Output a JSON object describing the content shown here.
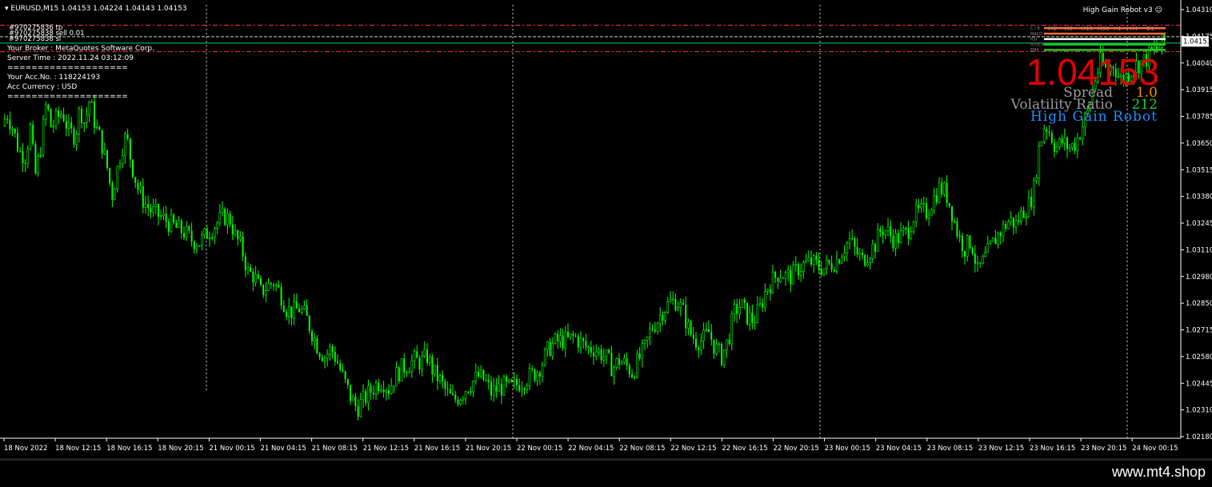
{
  "window": {
    "symbol_header": "EURUSD,M15  1.04153 1.04224 1.04143 1.04153",
    "ea_label": "High Gain Robot v3",
    "watermark": "www.mt4.shop"
  },
  "trade_labels": [
    "#970275836 tp",
    "#970275838 sell 0.01",
    "#970275838 sl"
  ],
  "account_info": [
    "Your Broker  : MetaQuotes Software Corp.",
    "Server Time : 2022.11.24 03:12:09",
    "====================",
    "Your Acc.No.  : 118224193",
    "Acc Currency  : USD",
    "===================="
  ],
  "price_display": {
    "value": "1.04153",
    "spread_label": "Spread",
    "spread_value": "1.0",
    "volatility_label": "Volatility Ratio",
    "volatility_value": "212",
    "robot_name": "High Gain Robot"
  },
  "dashboard": {
    "timeframes": [
      "M1",
      "M5",
      "M15",
      "M30",
      "H1",
      "H4",
      "D1"
    ],
    "rows": [
      "C / B",
      "MACD",
      "RSI",
      "STOCH",
      "EMA"
    ]
  },
  "current_price_tag": "1.04153",
  "colors": {
    "up": "#00ff00",
    "bg": "#000000",
    "price": "#e10000",
    "level": "#ff3333",
    "spread": "#ff8c00",
    "volatility": "#22cc22",
    "robot": "#1e90ff"
  },
  "chart_data": {
    "type": "candlestick",
    "symbol": "EURUSD",
    "timeframe": "M15",
    "ylim": [
      1.0218,
      1.0431
    ],
    "y_ticks": [
      "1.04310",
      "1.04175",
      "1.04040",
      "1.03915",
      "1.03785",
      "1.03650",
      "1.03515",
      "1.03380",
      "1.03245",
      "1.03110",
      "1.02980",
      "1.02850",
      "1.02715",
      "1.02580",
      "1.02445",
      "1.02310",
      "1.02180"
    ],
    "x_ticks": [
      "18 Nov 2022",
      "18 Nov 12:15",
      "18 Nov 16:15",
      "18 Nov 20:15",
      "21 Nov 00:15",
      "21 Nov 04:15",
      "21 Nov 08:15",
      "21 Nov 12:15",
      "21 Nov 16:15",
      "21 Nov 20:15",
      "22 Nov 00:15",
      "22 Nov 04:15",
      "22 Nov 08:15",
      "22 Nov 12:15",
      "22 Nov 16:15",
      "22 Nov 20:15",
      "23 Nov 00:15",
      "23 Nov 04:15",
      "23 Nov 08:15",
      "23 Nov 12:15",
      "23 Nov 16:15",
      "23 Nov 20:15",
      "24 Nov 00:15"
    ],
    "close_path": [
      [
        0,
        1.0366
      ],
      [
        8,
        1.038
      ],
      [
        16,
        1.0372
      ],
      [
        24,
        1.036
      ],
      [
        32,
        1.0358
      ],
      [
        38,
        1.0372
      ],
      [
        44,
        1.0348
      ],
      [
        50,
        1.036
      ],
      [
        58,
        1.0385
      ],
      [
        64,
        1.0372
      ],
      [
        70,
        1.0376
      ],
      [
        78,
        1.038
      ],
      [
        86,
        1.037
      ],
      [
        94,
        1.0368
      ],
      [
        100,
        1.0382
      ],
      [
        106,
        1.0374
      ],
      [
        112,
        1.0386
      ],
      [
        120,
        1.0372
      ],
      [
        126,
        1.0366
      ],
      [
        134,
        1.0352
      ],
      [
        140,
        1.0338
      ],
      [
        146,
        1.035
      ],
      [
        152,
        1.0362
      ],
      [
        158,
        1.0368
      ],
      [
        164,
        1.0355
      ],
      [
        172,
        1.0342
      ],
      [
        180,
        1.0335
      ],
      [
        190,
        1.033
      ],
      [
        200,
        1.0328
      ],
      [
        210,
        1.0325
      ],
      [
        220,
        1.0322
      ],
      [
        230,
        1.032
      ],
      [
        240,
        1.0316
      ],
      [
        250,
        1.0315
      ],
      [
        260,
        1.032
      ],
      [
        270,
        1.0324
      ],
      [
        280,
        1.0328
      ],
      [
        288,
        1.0326
      ],
      [
        294,
        1.0318
      ],
      [
        302,
        1.0312
      ],
      [
        310,
        1.03
      ],
      [
        318,
        1.0298
      ],
      [
        326,
        1.029
      ],
      [
        334,
        1.0293
      ],
      [
        342,
        1.0295
      ],
      [
        350,
        1.029
      ],
      [
        358,
        1.0282
      ],
      [
        366,
        1.028
      ],
      [
        374,
        1.0282
      ],
      [
        382,
        1.0278
      ],
      [
        390,
        1.027
      ],
      [
        398,
        1.0262
      ],
      [
        406,
        1.0258
      ],
      [
        414,
        1.0262
      ],
      [
        422,
        1.0255
      ],
      [
        430,
        1.0246
      ],
      [
        438,
        1.0238
      ],
      [
        446,
        1.0232
      ],
      [
        454,
        1.0236
      ],
      [
        462,
        1.024
      ],
      [
        470,
        1.0244
      ],
      [
        478,
        1.0246
      ],
      [
        486,
        1.0242
      ],
      [
        494,
        1.0248
      ],
      [
        502,
        1.0252
      ],
      [
        510,
        1.0254
      ],
      [
        518,
        1.0256
      ],
      [
        526,
        1.0255
      ],
      [
        534,
        1.0258
      ],
      [
        542,
        1.025
      ],
      [
        550,
        1.0246
      ],
      [
        558,
        1.024
      ],
      [
        566,
        1.0236
      ],
      [
        574,
        1.0238
      ],
      [
        582,
        1.0242
      ],
      [
        590,
        1.0245
      ],
      [
        598,
        1.0248
      ],
      [
        606,
        1.0246
      ],
      [
        614,
        1.024
      ],
      [
        622,
        1.0242
      ],
      [
        630,
        1.0243
      ],
      [
        638,
        1.0242
      ],
      [
        646,
        1.0244
      ],
      [
        654,
        1.0246
      ],
      [
        662,
        1.0248
      ],
      [
        670,
        1.025
      ],
      [
        678,
        1.0255
      ],
      [
        686,
        1.0262
      ],
      [
        694,
        1.0265
      ],
      [
        702,
        1.0266
      ],
      [
        710,
        1.0266
      ],
      [
        718,
        1.0268
      ],
      [
        726,
        1.0265
      ],
      [
        734,
        1.0262
      ],
      [
        742,
        1.0262
      ],
      [
        750,
        1.026
      ],
      [
        758,
        1.0257
      ],
      [
        766,
        1.0252
      ],
      [
        774,
        1.0256
      ],
      [
        782,
        1.0254
      ],
      [
        790,
        1.025
      ],
      [
        798,
        1.0256
      ],
      [
        806,
        1.0262
      ],
      [
        814,
        1.0272
      ],
      [
        822,
        1.0276
      ],
      [
        830,
        1.0282
      ],
      [
        838,
        1.0285
      ],
      [
        846,
        1.0286
      ],
      [
        854,
        1.028
      ],
      [
        862,
        1.027
      ],
      [
        870,
        1.0266
      ],
      [
        878,
        1.0266
      ],
      [
        886,
        1.027
      ],
      [
        894,
        1.0262
      ],
      [
        902,
        1.0258
      ],
      [
        910,
        1.0266
      ],
      [
        918,
        1.028
      ],
      [
        926,
        1.0284
      ],
      [
        934,
        1.0278
      ],
      [
        942,
        1.0276
      ],
      [
        950,
        1.0282
      ],
      [
        958,
        1.0292
      ],
      [
        966,
        1.0296
      ],
      [
        974,
        1.03
      ],
      [
        982,
        1.0298
      ],
      [
        990,
        1.0298
      ],
      [
        998,
        1.0302
      ],
      [
        1006,
        1.0304
      ],
      [
        1014,
        1.0305
      ],
      [
        1022,
        1.0303
      ],
      [
        1030,
        1.0302
      ],
      [
        1038,
        1.0304
      ],
      [
        1046,
        1.0306
      ],
      [
        1054,
        1.0312
      ],
      [
        1062,
        1.0316
      ],
      [
        1070,
        1.031
      ],
      [
        1078,
        1.0306
      ],
      [
        1086,
        1.031
      ],
      [
        1094,
        1.0314
      ],
      [
        1102,
        1.0322
      ],
      [
        1110,
        1.032
      ],
      [
        1118,
        1.0316
      ],
      [
        1126,
        1.0318
      ],
      [
        1134,
        1.032
      ],
      [
        1142,
        1.0328
      ],
      [
        1150,
        1.033
      ],
      [
        1158,
        1.033
      ],
      [
        1166,
        1.0336
      ],
      [
        1174,
        1.0342
      ],
      [
        1182,
        1.034
      ],
      [
        1190,
        1.033
      ],
      [
        1198,
        1.0318
      ],
      [
        1206,
        1.0312
      ],
      [
        1214,
        1.0316
      ],
      [
        1222,
        1.03
      ],
      [
        1230,
        1.0306
      ],
      [
        1238,
        1.0312
      ],
      [
        1246,
        1.0318
      ],
      [
        1254,
        1.0322
      ],
      [
        1262,
        1.0326
      ],
      [
        1270,
        1.0324
      ],
      [
        1278,
        1.033
      ],
      [
        1286,
        1.0334
      ],
      [
        1292,
        1.034
      ],
      [
        1298,
        1.036
      ],
      [
        1306,
        1.0374
      ],
      [
        1312,
        1.037
      ],
      [
        1320,
        1.0362
      ],
      [
        1328,
        1.0365
      ],
      [
        1336,
        1.0362
      ],
      [
        1344,
        1.0364
      ],
      [
        1352,
        1.0372
      ],
      [
        1360,
        1.038
      ],
      [
        1368,
        1.0395
      ],
      [
        1376,
        1.0405
      ],
      [
        1384,
        1.04
      ],
      [
        1392,
        1.0404
      ],
      [
        1400,
        1.0396
      ],
      [
        1408,
        1.0398
      ],
      [
        1416,
        1.0402
      ],
      [
        1424,
        1.0404
      ],
      [
        1432,
        1.0406
      ],
      [
        1440,
        1.041
      ],
      [
        1448,
        1.0412
      ],
      [
        1455,
        1.04153
      ]
    ],
    "levels": [
      1.04224,
      1.04175,
      1.04143,
      1.041
    ]
  }
}
